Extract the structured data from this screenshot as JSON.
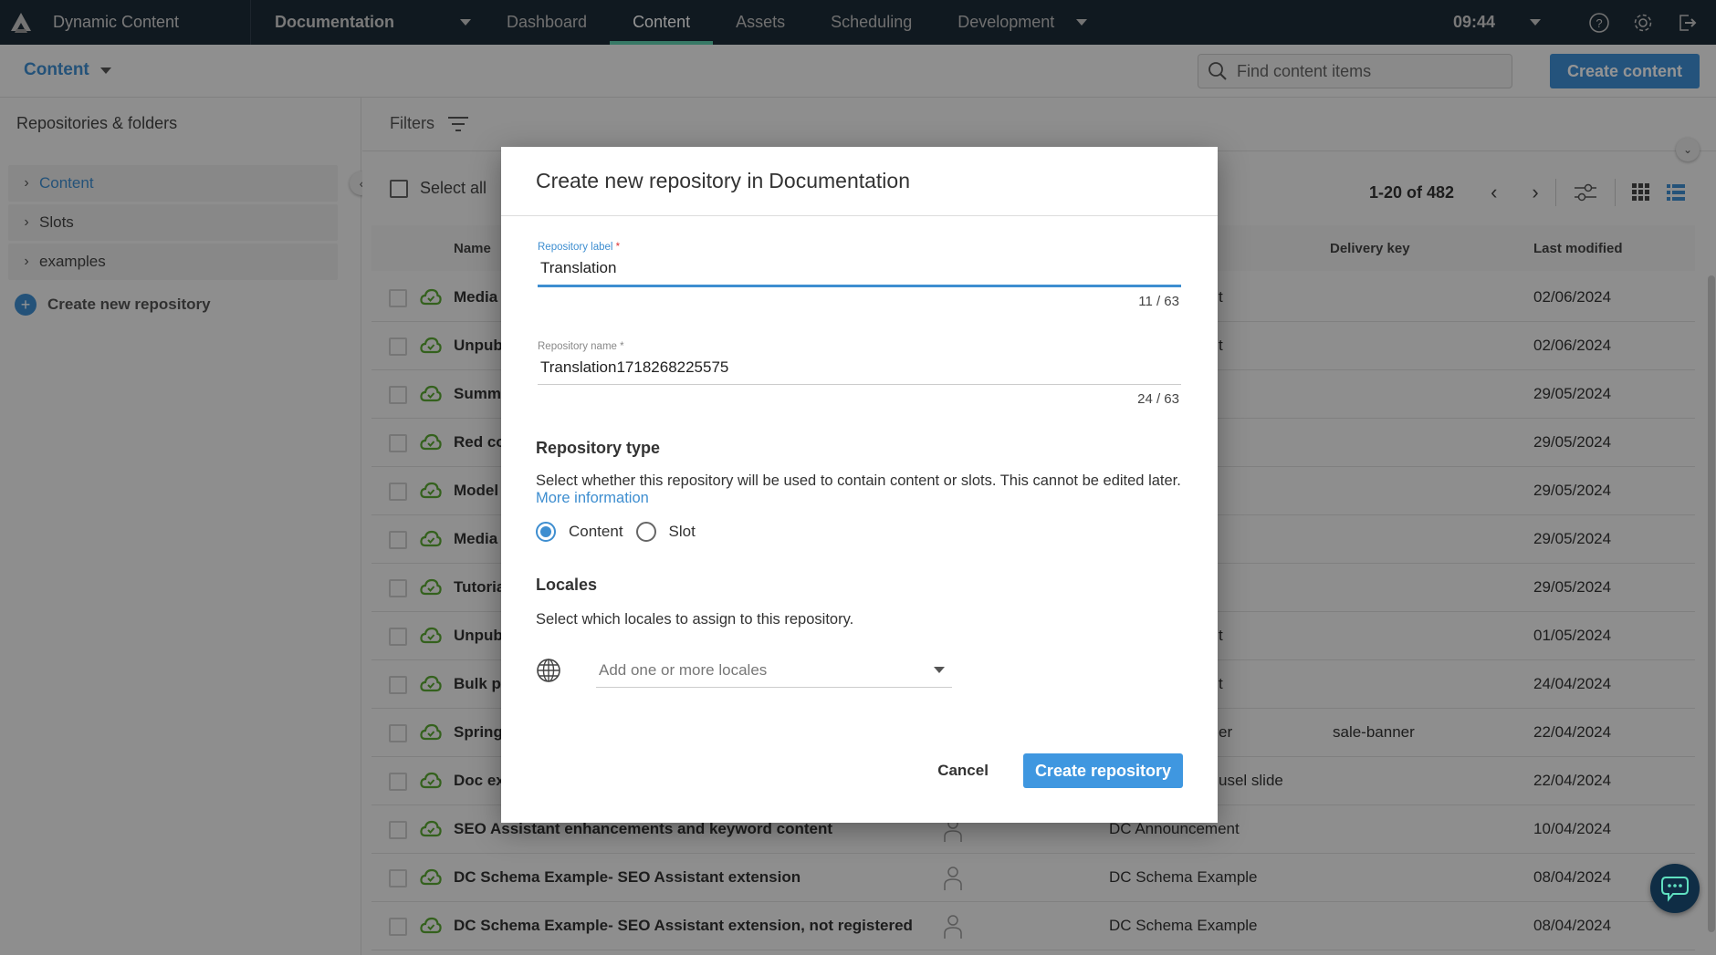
{
  "topnav": {
    "app_title": "Dynamic Content",
    "hub": "Documentation",
    "tabs": [
      {
        "label": "Dashboard",
        "active": false
      },
      {
        "label": "Content",
        "active": true
      },
      {
        "label": "Assets",
        "active": false
      },
      {
        "label": "Scheduling",
        "active": false
      },
      {
        "label": "Development",
        "active": false
      }
    ],
    "time": "09:44",
    "icons": [
      "help-icon",
      "settings-icon",
      "logout-icon"
    ]
  },
  "subheader": {
    "section_menu": "Content",
    "search_placeholder": "Find content items",
    "create_button": "Create content"
  },
  "sidebar": {
    "title": "Repositories & folders",
    "items": [
      {
        "label": "Content",
        "active": true
      },
      {
        "label": "Slots",
        "active": false
      },
      {
        "label": "examples",
        "active": false
      }
    ],
    "create_repo": "Create new repository"
  },
  "main": {
    "filters_label": "Filters",
    "select_all": "Select all",
    "pagination": "1-20 of 482",
    "columns": {
      "name": "Name",
      "delivery_key": "Delivery key",
      "last_modified": "Last modified"
    },
    "rows": [
      {
        "name": "Media",
        "type": "t",
        "key": "",
        "modified": "02/06/2024"
      },
      {
        "name": "Unpubl",
        "type": "t",
        "key": "",
        "modified": "02/06/2024"
      },
      {
        "name": "Summe",
        "type": "",
        "key": "",
        "modified": "29/05/2024"
      },
      {
        "name": "Red co",
        "type": "",
        "key": "",
        "modified": "29/05/2024"
      },
      {
        "name": "Model",
        "type": "",
        "key": "",
        "modified": "29/05/2024"
      },
      {
        "name": "Media",
        "type": "",
        "key": "",
        "modified": "29/05/2024"
      },
      {
        "name": "Tutoria",
        "type": "",
        "key": "",
        "modified": "29/05/2024"
      },
      {
        "name": "Unpubl",
        "type": "t",
        "key": "",
        "modified": "01/05/2024"
      },
      {
        "name": "Bulk pr",
        "type": "t",
        "key": "",
        "modified": "24/04/2024"
      },
      {
        "name": "Spring",
        "type": "er",
        "key": "sale-banner",
        "modified": "22/04/2024"
      },
      {
        "name": "Doc ex",
        "type": "usel slide",
        "key": "",
        "modified": "22/04/2024"
      },
      {
        "name": "SEO Assistant enhancements and keyword content",
        "type": "DC Announcement",
        "key": "",
        "modified": "10/04/2024"
      },
      {
        "name": "DC Schema Example- SEO Assistant extension",
        "type": "DC Schema Example",
        "key": "",
        "modified": "08/04/2024"
      },
      {
        "name": "DC Schema Example- SEO Assistant extension, not registered",
        "type": "DC Schema Example",
        "key": "",
        "modified": "08/04/2024"
      }
    ]
  },
  "modal": {
    "title_prefix": "Create new repository in",
    "title_hub": "Documentation",
    "label_field": {
      "label": "Repository label",
      "required": "*",
      "value": "Translation",
      "count": "11 / 63"
    },
    "name_field": {
      "label": "Repository name",
      "required": "*",
      "value": "Translation1718268225575",
      "count": "24 / 63"
    },
    "type_section": {
      "title": "Repository type",
      "description": "Select whether this repository will be used to contain content or slots. This cannot be edited later.",
      "link": "More information",
      "options": [
        {
          "label": "Content",
          "checked": true
        },
        {
          "label": "Slot",
          "checked": false
        }
      ]
    },
    "locales_section": {
      "title": "Locales",
      "description": "Select which locales to assign to this repository.",
      "placeholder": "Add one or more locales"
    },
    "cancel": "Cancel",
    "submit": "Create repository"
  },
  "colors": {
    "accent": "#3e8ed0",
    "nav_bg": "#1d2b38",
    "nav_active": "#5fd0b0",
    "published": "#5aa832"
  }
}
